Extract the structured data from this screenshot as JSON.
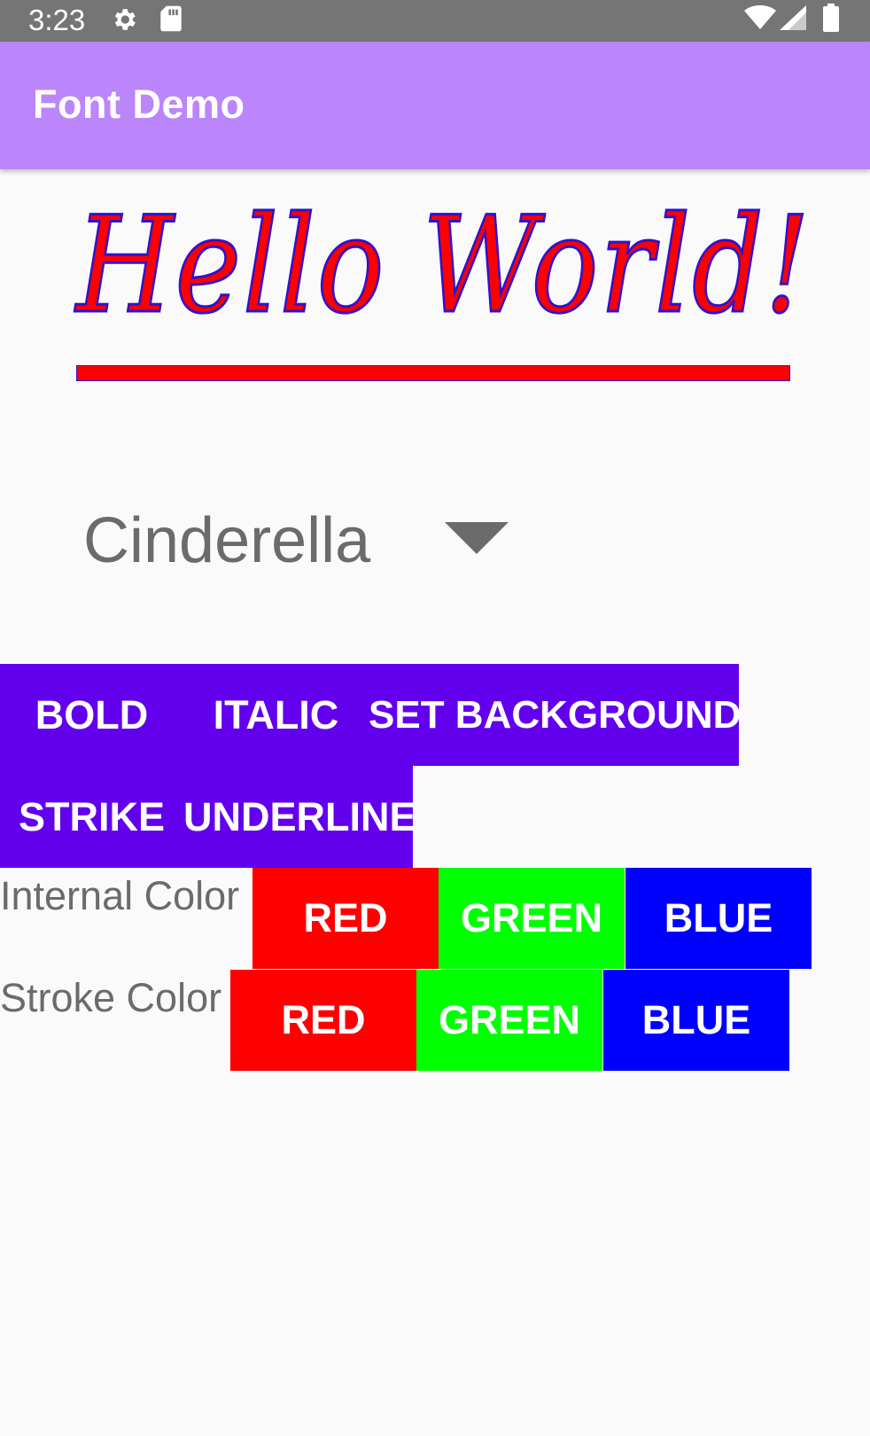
{
  "status_bar": {
    "time": "3:23",
    "icons": [
      "gear-icon",
      "sd-card-icon",
      "wifi-icon",
      "signal-icon",
      "battery-icon"
    ]
  },
  "app_bar": {
    "title": "Font Demo",
    "color": "#bb86fc"
  },
  "preview": {
    "text": "Hello World!",
    "fill_color": "#ff0000",
    "stroke_color": "#3311cc",
    "underlined": true
  },
  "font_spinner": {
    "selected": "Cinderella"
  },
  "style_buttons": {
    "bold": "BOLD",
    "italic": "ITALIC",
    "set_background": "SET BACKGROUND",
    "strike": "STRIKE",
    "underline": "UNDERLINE",
    "color": "#6200ee"
  },
  "internal_color": {
    "label": "Internal Color",
    "red": "RED",
    "green": "GREEN",
    "blue": "BLUE"
  },
  "stroke_color": {
    "label": "Stroke Color",
    "red": "RED",
    "green": "GREEN",
    "blue": "BLUE"
  },
  "colors": {
    "red": "#ff0000",
    "green": "#00ff00",
    "blue": "#0000ff"
  }
}
